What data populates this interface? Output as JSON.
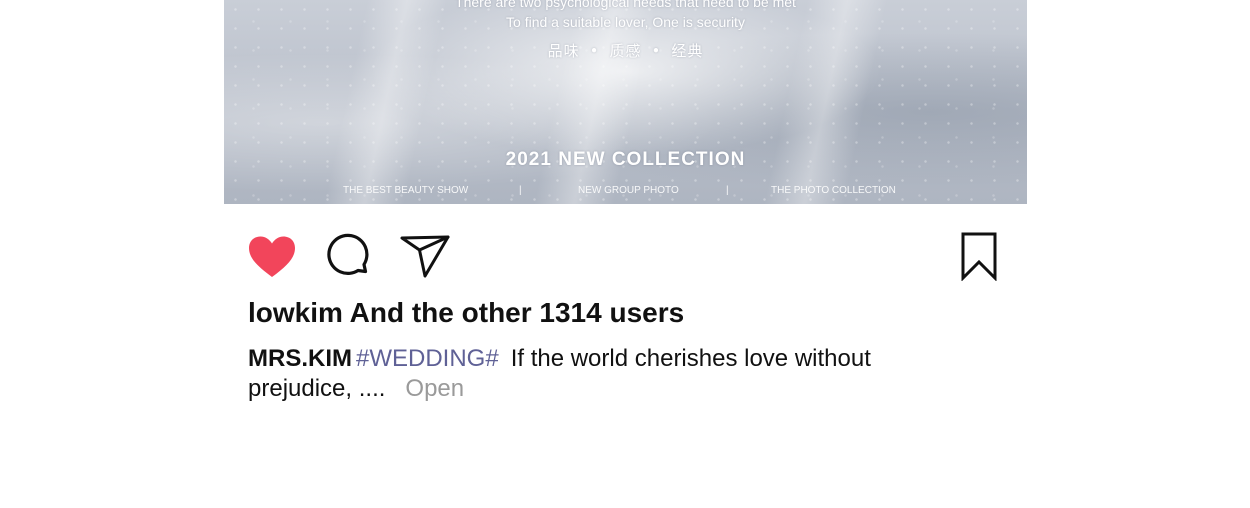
{
  "post": {
    "image": {
      "line1": "There are two psychological needs that need to be met",
      "line2": "To find a suitable lover, One is security",
      "cn_words": [
        "品味",
        "质感",
        "经典"
      ],
      "cn_separator": "•",
      "collection": "2021 NEW COLLECTION",
      "footer_items": [
        "THE BEST BEAUTY SHOW",
        "NEW GROUP PHOTO",
        "THE PHOTO COLLECTION"
      ],
      "footer_separator": "|"
    },
    "actions": {
      "like_icon": "heart-filled-icon",
      "comment_icon": "comment-bubble-icon",
      "share_icon": "paper-plane-icon",
      "bookmark_icon": "bookmark-icon",
      "liked": true
    },
    "likes_text": "lowkim And the other 1314 users",
    "caption": {
      "username": "MRS.KIM",
      "hashtag": "#WEDDING#",
      "text": "If the world cherishes love without prejudice, ....",
      "open_label": "Open"
    }
  },
  "colors": {
    "heart": "#f2455b",
    "hashtag": "#5f6196",
    "open_link": "#9a9a9a",
    "text": "#111111"
  }
}
